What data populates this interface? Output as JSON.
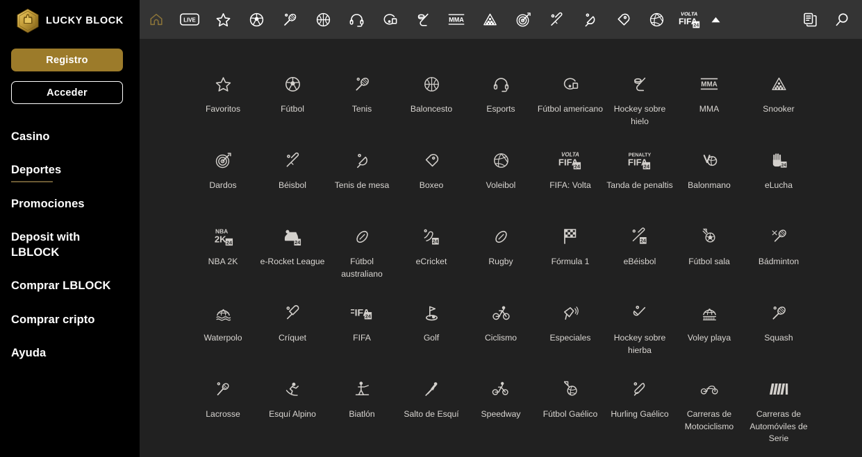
{
  "brand": {
    "name": "LUCKY BLOCK",
    "logo_icon": "lucky-block-hex-logo",
    "accent_gold": "#9c7b2a",
    "accent_gold_active": "#8a7339"
  },
  "sidebar": {
    "register_label": "Registro",
    "login_label": "Acceder",
    "items": [
      {
        "label": "Casino",
        "active": false
      },
      {
        "label": "Deportes",
        "active": true
      },
      {
        "label": "Promociones",
        "active": false
      },
      {
        "label": "Deposit with LBLOCK",
        "active": false
      },
      {
        "label": "Comprar LBLOCK",
        "active": false
      },
      {
        "label": "Comprar cripto",
        "active": false
      },
      {
        "label": "Ayuda",
        "active": false
      }
    ]
  },
  "topbar": {
    "icons": [
      {
        "name": "home-icon",
        "active": true
      },
      {
        "name": "live-icon",
        "active": false
      },
      {
        "name": "star-icon",
        "active": false
      },
      {
        "name": "football-icon",
        "active": false
      },
      {
        "name": "tennis-icon",
        "active": false
      },
      {
        "name": "basketball-icon",
        "active": false
      },
      {
        "name": "esports-headset-icon",
        "active": false
      },
      {
        "name": "american-football-icon",
        "active": false
      },
      {
        "name": "ice-hockey-icon",
        "active": false
      },
      {
        "name": "mma-icon",
        "active": false
      },
      {
        "name": "snooker-icon",
        "active": false
      },
      {
        "name": "darts-icon",
        "active": false
      },
      {
        "name": "baseball-icon",
        "active": false
      },
      {
        "name": "table-tennis-icon",
        "active": false
      },
      {
        "name": "boxing-icon",
        "active": false
      },
      {
        "name": "volleyball-icon",
        "active": false
      },
      {
        "name": "fifa-volta-icon",
        "active": false
      }
    ],
    "collapse_icon": "chevron-up-icon",
    "right_icons": [
      {
        "name": "betslip-icon"
      },
      {
        "name": "search-icon"
      }
    ],
    "live_label": "LIVE",
    "mma_label": "MMA",
    "volta_label": "VOLTA",
    "fifa_label": "FIFA",
    "badge_24": "24"
  },
  "sports": [
    {
      "label": "Favoritos",
      "icon": "star-icon"
    },
    {
      "label": "Fútbol",
      "icon": "football-icon"
    },
    {
      "label": "Tenis",
      "icon": "tennis-icon"
    },
    {
      "label": "Baloncesto",
      "icon": "basketball-icon"
    },
    {
      "label": "Esports",
      "icon": "esports-headset-icon"
    },
    {
      "label": "Fútbol americano",
      "icon": "american-football-icon"
    },
    {
      "label": "Hockey sobre hielo",
      "icon": "ice-hockey-icon"
    },
    {
      "label": "MMA",
      "icon": "mma-icon"
    },
    {
      "label": "Snooker",
      "icon": "snooker-icon"
    },
    {
      "label": "Dardos",
      "icon": "darts-icon"
    },
    {
      "label": "Béisbol",
      "icon": "baseball-icon"
    },
    {
      "label": "Tenis de mesa",
      "icon": "table-tennis-icon"
    },
    {
      "label": "Boxeo",
      "icon": "boxing-icon"
    },
    {
      "label": "Voleibol",
      "icon": "volleyball-icon"
    },
    {
      "label": "FIFA: Volta",
      "icon": "fifa-volta-icon"
    },
    {
      "label": "Tanda de penaltis",
      "icon": "fifa-penalty-icon"
    },
    {
      "label": "Balonmano",
      "icon": "handball-icon"
    },
    {
      "label": "eLucha",
      "icon": "ewrestling-icon"
    },
    {
      "label": "NBA 2K",
      "icon": "nba2k-icon"
    },
    {
      "label": "e-Rocket League",
      "icon": "erocket-league-icon"
    },
    {
      "label": "Fútbol australiano",
      "icon": "aussie-rules-icon"
    },
    {
      "label": "eCricket",
      "icon": "ecricket-icon"
    },
    {
      "label": "Rugby",
      "icon": "rugby-icon"
    },
    {
      "label": "Fórmula 1",
      "icon": "formula1-flag-icon"
    },
    {
      "label": "eBéisbol",
      "icon": "ebaseball-icon"
    },
    {
      "label": "Fútbol sala",
      "icon": "futsal-icon"
    },
    {
      "label": "Bádminton",
      "icon": "badminton-icon"
    },
    {
      "label": "Waterpolo",
      "icon": "waterpolo-icon"
    },
    {
      "label": "Críquet",
      "icon": "cricket-icon"
    },
    {
      "label": "FIFA",
      "icon": "fifa-icon"
    },
    {
      "label": "Golf",
      "icon": "golf-icon"
    },
    {
      "label": "Ciclismo",
      "icon": "cycling-icon"
    },
    {
      "label": "Especiales",
      "icon": "megaphone-icon"
    },
    {
      "label": "Hockey sobre hierba",
      "icon": "field-hockey-icon"
    },
    {
      "label": "Voley playa",
      "icon": "beach-volleyball-icon"
    },
    {
      "label": "Squash",
      "icon": "squash-icon"
    },
    {
      "label": "Lacrosse",
      "icon": "lacrosse-icon"
    },
    {
      "label": "Esquí Alpino",
      "icon": "alpine-skiing-icon"
    },
    {
      "label": "Biatlón",
      "icon": "biathlon-icon"
    },
    {
      "label": "Salto de Esquí",
      "icon": "ski-jumping-icon"
    },
    {
      "label": "Speedway",
      "icon": "speedway-icon"
    },
    {
      "label": "Fútbol Gaélico",
      "icon": "gaelic-football-icon"
    },
    {
      "label": "Hurling Gaélico",
      "icon": "hurling-icon"
    },
    {
      "label": "Carreras de Motociclismo",
      "icon": "motorcycle-racing-icon"
    },
    {
      "label": "Carreras de Automóviles de Serie",
      "icon": "stock-car-racing-icon"
    }
  ]
}
